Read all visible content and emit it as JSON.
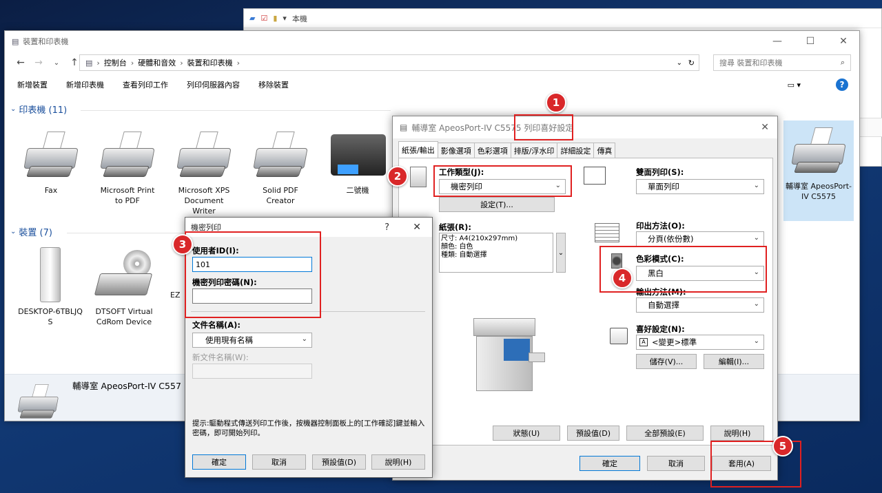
{
  "background_window": {
    "title": "本機"
  },
  "main_window": {
    "title": "裝置和印表機",
    "breadcrumb": [
      "控制台",
      "硬體和音效",
      "裝置和印表機"
    ],
    "search_placeholder": "搜尋 裝置和印表機",
    "commands": [
      "新增裝置",
      "新增印表機",
      "查看列印工作",
      "列印伺服器內容",
      "移除裝置"
    ],
    "printers_section": "印表機 (11)",
    "printers": [
      {
        "name": "Fax"
      },
      {
        "name": "Microsoft Print to PDF"
      },
      {
        "name": "Microsoft XPS Document Writer"
      },
      {
        "name": "Solid PDF Creator"
      },
      {
        "name": "二號機"
      },
      {
        "name": "輔導室 ApeosPort-IV C5575"
      }
    ],
    "devices_section": "裝置 (7)",
    "devices": [
      {
        "name": "DESKTOP-6TBLJQS"
      },
      {
        "name": "DTSOFT Virtual CdRom Device"
      },
      {
        "name": "EZ"
      }
    ],
    "details_name": "輔導室 ApeosPort-IV C557"
  },
  "pref_dialog": {
    "title": "輔導室 ApeosPort-IV C5575 列印喜好設定",
    "tabs": [
      "紙張/輸出",
      "影像選項",
      "色彩選項",
      "排版/浮水印",
      "詳細設定",
      "傳真"
    ],
    "job_type_label": "工作類型(J):",
    "job_type_value": "機密列印",
    "settings_button": "設定(T)...",
    "paper_label": "紙張(R):",
    "paper_lines": [
      "尺寸: A4(210x297mm)",
      "顏色: 白色",
      "種類: 自動選擇"
    ],
    "duplex_label": "雙面列印(S):",
    "duplex_value": "單面列印",
    "output_method_label": "印出方法(O):",
    "output_method_value": "分頁(依份數)",
    "color_mode_label": "色彩模式(C):",
    "color_mode_value": "黑白",
    "output_dest_label": "輸出方法(M):",
    "output_dest_value": "自動選擇",
    "favorites_label": "喜好設定(N):",
    "favorites_value": "<變更>標準",
    "save_button": "儲存(V)...",
    "edit_button": "編輯(I)...",
    "status_button": "狀態(U)",
    "default_button": "預設值(D)",
    "all_default_button": "全部預設(E)",
    "help_button": "說明(H)",
    "ok_button": "確定",
    "cancel_button": "取消",
    "apply_button": "套用(A)"
  },
  "secure_dialog": {
    "title": "機密列印",
    "user_id_label": "使用者ID(I):",
    "user_id_value": "101",
    "password_label": "機密列印密碼(N):",
    "password_value": "",
    "doc_name_label": "文件名稱(A):",
    "doc_name_value": "使用現有名稱",
    "new_doc_name_label": "新文件名稱(W):",
    "hint": "提示:驅動程式傳送列印工作後，按機器控制面板上的[工作確認]鍵並輸入密碼，即可開始列印。",
    "ok_button": "確定",
    "cancel_button": "取消",
    "default_button": "預設值(D)",
    "help_button": "說明(H)"
  },
  "annotations": [
    "1",
    "2",
    "3",
    "4",
    "5"
  ],
  "colors": {
    "annotation_red": "#e02020",
    "badge_red": "#d9282a",
    "link_blue": "#1a4f9c"
  }
}
